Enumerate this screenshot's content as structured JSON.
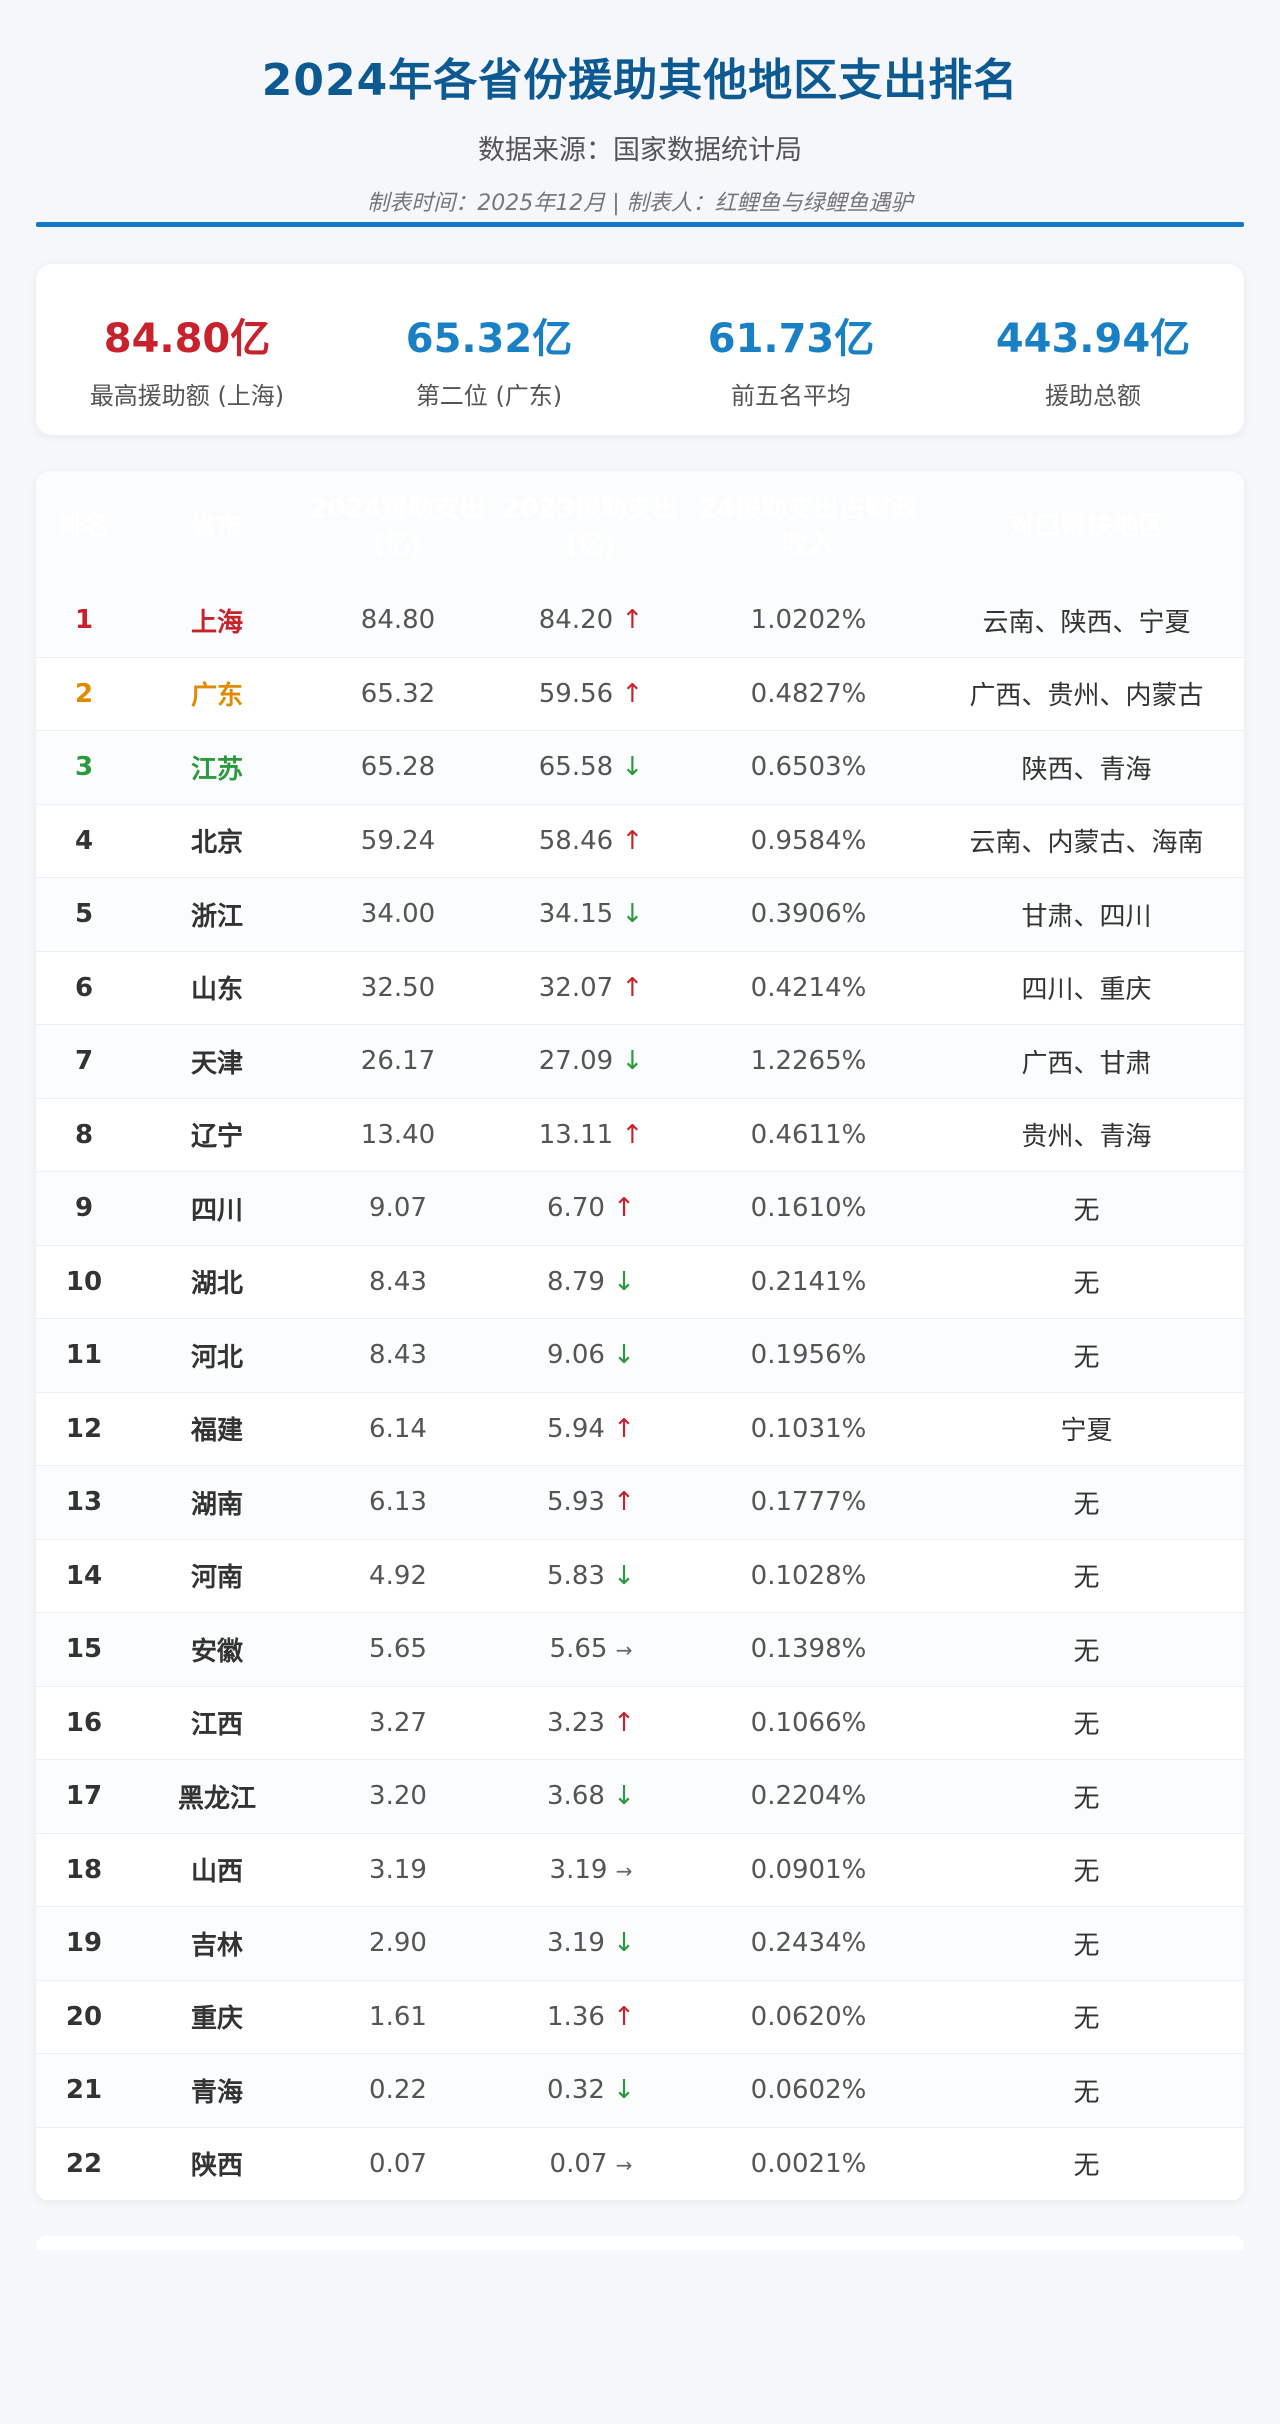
{
  "header": {
    "title": "2024年各省份援助其他地区支出排名",
    "source": "数据来源：国家数据统计局",
    "meta": "制表时间：2025年12月 | 制表人：红鲤鱼与绿鲤鱼遇驴"
  },
  "stats": [
    {
      "value": "84.80亿",
      "label": "最高援助额 (上海)"
    },
    {
      "value": "65.32亿",
      "label": "第二位 (广东)"
    },
    {
      "value": "61.73亿",
      "label": "前五名平均"
    },
    {
      "value": "443.94亿",
      "label": "援助总额"
    }
  ],
  "columns": [
    "排名",
    "省市",
    "2024援助支出(亿)",
    "2023援助支出(亿)",
    "24援助支出占财政收入",
    "对口帮扶地区"
  ],
  "colors": {
    "accent": "#0a85d8",
    "up": "#c8232c",
    "down": "#2a9a3c",
    "gold": "#e08a00",
    "green": "#2a9a3c"
  },
  "rows": [
    {
      "rank": "1",
      "prov": "上海",
      "v24": "84.80",
      "v23": "84.20",
      "trend": "↑",
      "ratio": "1.0202%",
      "partner": "云南、陕西、宁夏"
    },
    {
      "rank": "2",
      "prov": "广东",
      "v24": "65.32",
      "v23": "59.56",
      "trend": "↑",
      "ratio": "0.4827%",
      "partner": "广西、贵州、内蒙古"
    },
    {
      "rank": "3",
      "prov": "江苏",
      "v24": "65.28",
      "v23": "65.58",
      "trend": "↓",
      "ratio": "0.6503%",
      "partner": "陕西、青海"
    },
    {
      "rank": "4",
      "prov": "北京",
      "v24": "59.24",
      "v23": "58.46",
      "trend": "↑",
      "ratio": "0.9584%",
      "partner": "云南、内蒙古、海南"
    },
    {
      "rank": "5",
      "prov": "浙江",
      "v24": "34.00",
      "v23": "34.15",
      "trend": "↓",
      "ratio": "0.3906%",
      "partner": "甘肃、四川"
    },
    {
      "rank": "6",
      "prov": "山东",
      "v24": "32.50",
      "v23": "32.07",
      "trend": "↑",
      "ratio": "0.4214%",
      "partner": "四川、重庆"
    },
    {
      "rank": "7",
      "prov": "天津",
      "v24": "26.17",
      "v23": "27.09",
      "trend": "↓",
      "ratio": "1.2265%",
      "partner": "广西、甘肃"
    },
    {
      "rank": "8",
      "prov": "辽宁",
      "v24": "13.40",
      "v23": "13.11",
      "trend": "↑",
      "ratio": "0.4611%",
      "partner": "贵州、青海"
    },
    {
      "rank": "9",
      "prov": "四川",
      "v24": "9.07",
      "v23": "6.70",
      "trend": "↑",
      "ratio": "0.1610%",
      "partner": "无"
    },
    {
      "rank": "10",
      "prov": "湖北",
      "v24": "8.43",
      "v23": "8.79",
      "trend": "↓",
      "ratio": "0.2141%",
      "partner": "无"
    },
    {
      "rank": "11",
      "prov": "河北",
      "v24": "8.43",
      "v23": "9.06",
      "trend": "↓",
      "ratio": "0.1956%",
      "partner": "无"
    },
    {
      "rank": "12",
      "prov": "福建",
      "v24": "6.14",
      "v23": "5.94",
      "trend": "↑",
      "ratio": "0.1031%",
      "partner": "宁夏"
    },
    {
      "rank": "13",
      "prov": "湖南",
      "v24": "6.13",
      "v23": "5.93",
      "trend": "↑",
      "ratio": "0.1777%",
      "partner": "无"
    },
    {
      "rank": "14",
      "prov": "河南",
      "v24": "4.92",
      "v23": "5.83",
      "trend": "↓",
      "ratio": "0.1028%",
      "partner": "无"
    },
    {
      "rank": "15",
      "prov": "安徽",
      "v24": "5.65",
      "v23": "5.65",
      "trend": "→",
      "ratio": "0.1398%",
      "partner": "无"
    },
    {
      "rank": "16",
      "prov": "江西",
      "v24": "3.27",
      "v23": "3.23",
      "trend": "↑",
      "ratio": "0.1066%",
      "partner": "无"
    },
    {
      "rank": "17",
      "prov": "黑龙江",
      "v24": "3.20",
      "v23": "3.68",
      "trend": "↓",
      "ratio": "0.2204%",
      "partner": "无"
    },
    {
      "rank": "18",
      "prov": "山西",
      "v24": "3.19",
      "v23": "3.19",
      "trend": "→",
      "ratio": "0.0901%",
      "partner": "无"
    },
    {
      "rank": "19",
      "prov": "吉林",
      "v24": "2.90",
      "v23": "3.19",
      "trend": "↓",
      "ratio": "0.2434%",
      "partner": "无"
    },
    {
      "rank": "20",
      "prov": "重庆",
      "v24": "1.61",
      "v23": "1.36",
      "trend": "↑",
      "ratio": "0.0620%",
      "partner": "无"
    },
    {
      "rank": "21",
      "prov": "青海",
      "v24": "0.22",
      "v23": "0.32",
      "trend": "↓",
      "ratio": "0.0602%",
      "partner": "无"
    },
    {
      "rank": "22",
      "prov": "陕西",
      "v24": "0.07",
      "v23": "0.07",
      "trend": "→",
      "ratio": "0.0021%",
      "partner": "无"
    }
  ]
}
